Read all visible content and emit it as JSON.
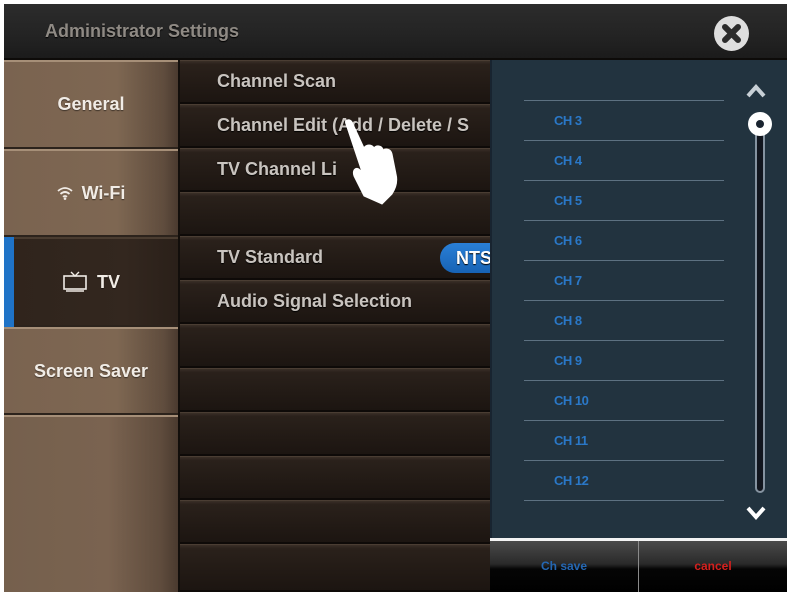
{
  "window": {
    "title": "Administrator Settings",
    "close_icon": "close-circle-icon"
  },
  "sidebar": {
    "items": [
      {
        "label": "General",
        "icon": null,
        "active": false
      },
      {
        "label": "Wi-Fi",
        "icon": "wifi-icon",
        "active": false
      },
      {
        "label": "TV",
        "icon": "tv-icon",
        "active": true
      },
      {
        "label": "Screen Saver",
        "icon": null,
        "active": false
      }
    ],
    "accent_color": "#1f73c7"
  },
  "tv_settings": {
    "rows": [
      {
        "label": "Channel Scan"
      },
      {
        "label": "Channel  Edit (Add / Delete / S"
      },
      {
        "label": "TV Channel Li"
      },
      {
        "label": ""
      },
      {
        "label": "TV Standard",
        "value": "NTS"
      },
      {
        "label": "Audio Signal Selection"
      },
      {
        "label": ""
      },
      {
        "label": ""
      },
      {
        "label": ""
      },
      {
        "label": ""
      },
      {
        "label": ""
      },
      {
        "label": ""
      }
    ]
  },
  "channel_list": {
    "channels": [
      "CH 3",
      "CH 4",
      "CH 5",
      "CH 6",
      "CH 7",
      "CH 8",
      "CH 9",
      "CH 10",
      "CH 11",
      "CH 12"
    ],
    "scroll_up_icon": "chevron-up-icon",
    "scroll_down_icon": "chevron-down-icon",
    "scroll_position": 0,
    "text_color": "#2a78c8"
  },
  "actions": {
    "save_label": "Ch save",
    "cancel_label": "cancel",
    "save_color": "#2467b3",
    "cancel_color": "#d4201e"
  },
  "overlay": {
    "cursor_icon": "hand-pointer-icon"
  }
}
